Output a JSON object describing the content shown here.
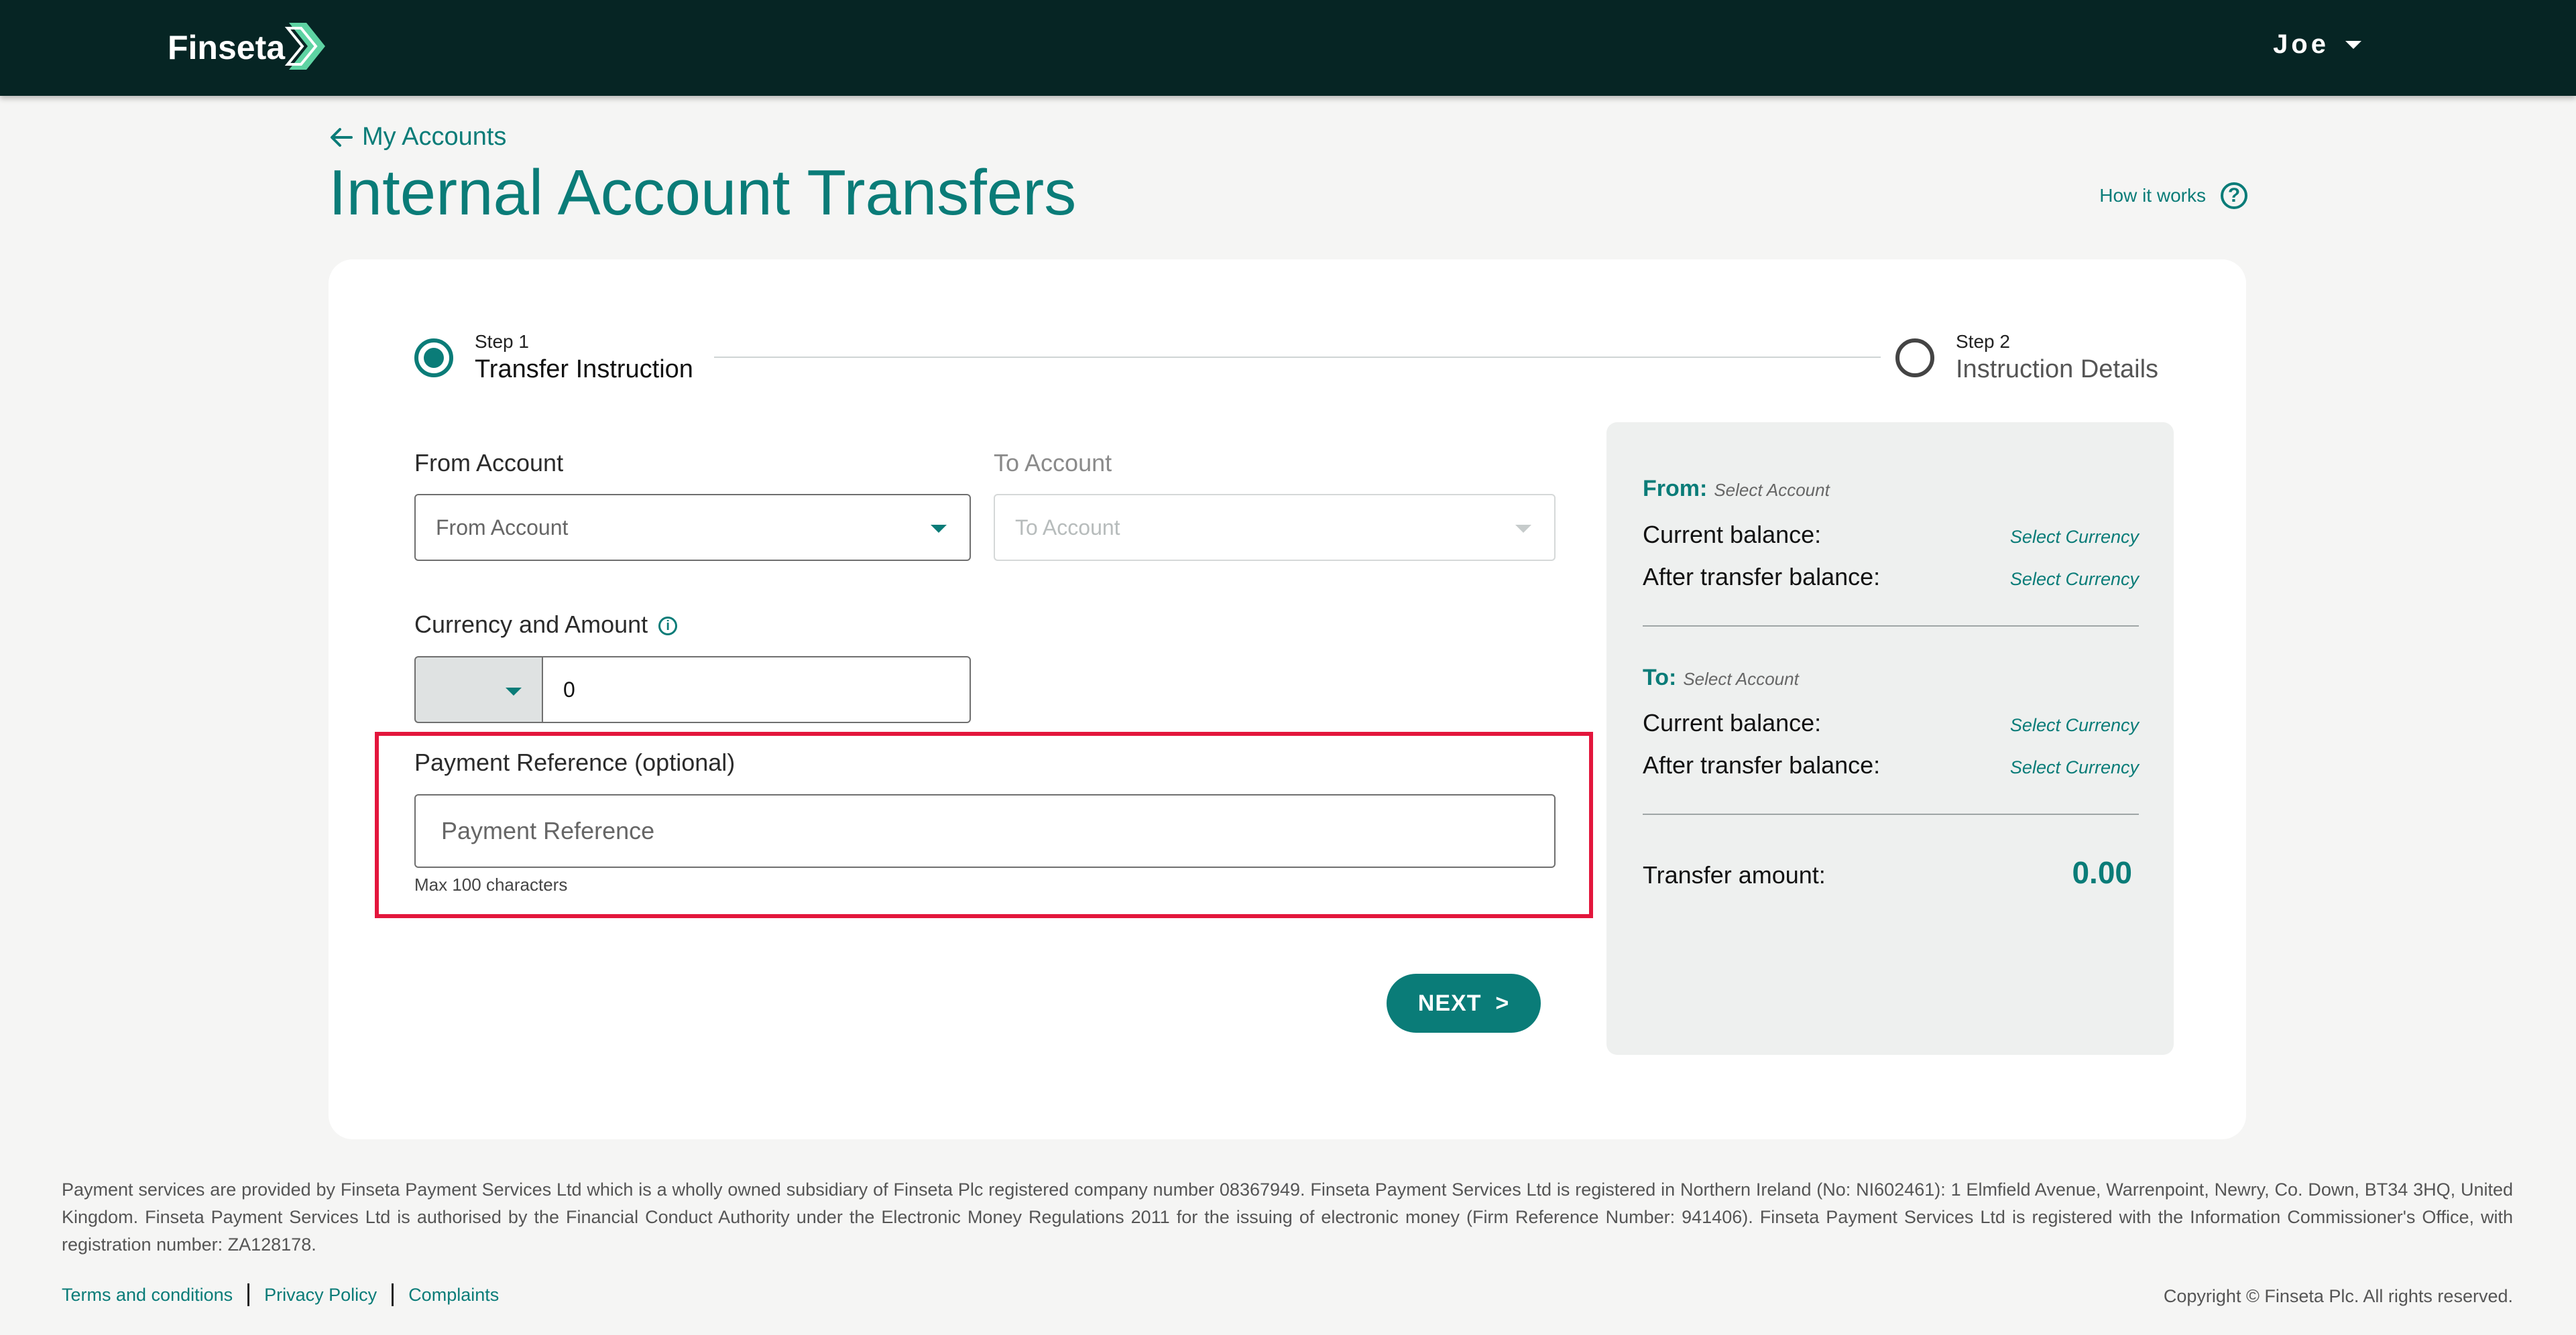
{
  "header": {
    "brand": "Finseta",
    "user_name": "Joe"
  },
  "nav": {
    "back_label": "My Accounts"
  },
  "page": {
    "title": "Internal Account Transfers",
    "help_link": "How it works"
  },
  "steps": [
    {
      "number": "Step 1",
      "title": "Transfer Instruction",
      "active": true
    },
    {
      "number": "Step 2",
      "title": "Instruction Details",
      "active": false
    }
  ],
  "form": {
    "from_account": {
      "label": "From Account",
      "placeholder": "From Account"
    },
    "to_account": {
      "label": "To Account",
      "placeholder": "To Account"
    },
    "currency_amount": {
      "label": "Currency and Amount",
      "currency_value": "",
      "amount_value": "0"
    },
    "payment_reference": {
      "label": "Payment Reference (optional)",
      "placeholder": "Payment Reference",
      "hint": "Max 100 characters"
    },
    "next_button": "NEXT  >"
  },
  "summary": {
    "from": {
      "title": "From:",
      "account": "Select Account",
      "current_label": "Current balance:",
      "current_value": "Select Currency",
      "after_label": "After transfer balance:",
      "after_value": "Select Currency"
    },
    "to": {
      "title": "To:",
      "account": "Select Account",
      "current_label": "Current balance:",
      "current_value": "Select Currency",
      "after_label": "After transfer balance:",
      "after_value": "Select Currency"
    },
    "transfer_label": "Transfer amount:",
    "transfer_value": "0.00"
  },
  "footer": {
    "disclaimer": "Payment services are provided by Finseta Payment Services Ltd which is a wholly owned subsidiary of Finseta Plc registered company number 08367949. Finseta Payment Services Ltd is registered in Northern Ireland (No: NI602461): 1 Elmfield Avenue, Warrenpoint, Newry, Co. Down, BT34 3HQ, United Kingdom. Finseta Payment Services Ltd is authorised by the Financial Conduct Authority under the Electronic Money Regulations 2011 for the issuing of electronic money (Firm Reference Number: 941406). Finseta Payment Services Ltd is registered with the Information Commissioner's Office, with registration number: ZA128178.",
    "links": [
      "Terms and conditions",
      "Privacy Policy",
      "Complaints"
    ],
    "copyright": "Copyright © Finseta Plc. All rights reserved."
  },
  "colors": {
    "header_bg": "#062524",
    "accent": "#0a7c78",
    "highlight_border": "#e3163c",
    "page_bg": "#f5f5f4"
  },
  "icons": [
    "finseta-logo-icon",
    "chevron-down-icon",
    "arrow-left-icon",
    "help-circle-icon",
    "info-icon"
  ]
}
